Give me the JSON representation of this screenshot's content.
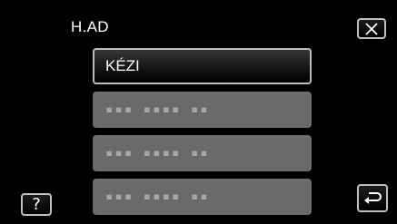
{
  "header": {
    "title": "H.AD"
  },
  "menu": {
    "items": [
      {
        "label": "KÉZI",
        "enabled": true
      },
      {
        "label": "▪▪▪ ▪▪▪▪ ▪▪",
        "enabled": false
      },
      {
        "label": "▪▪▪ ▪▪▪▪ ▪▪",
        "enabled": false
      },
      {
        "label": "▪▪▪ ▪▪▪▪ ▪▪",
        "enabled": false
      }
    ]
  },
  "controls": {
    "help_label": "?",
    "close_icon": "close-icon",
    "back_icon": "return-arrow-icon"
  },
  "colors": {
    "background": "#000000",
    "button_border": "#bdbdbd",
    "disabled_fill": "#6a6a6a"
  }
}
